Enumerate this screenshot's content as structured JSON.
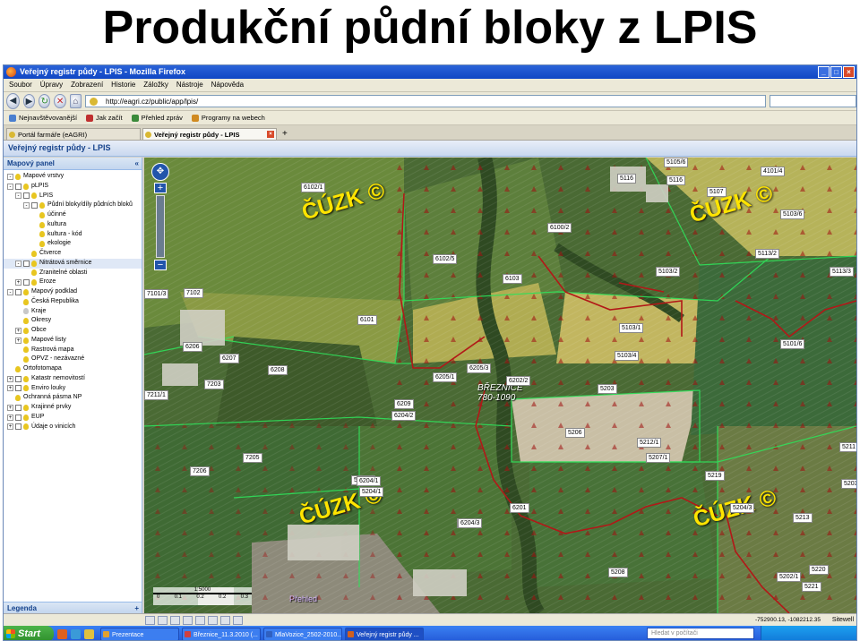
{
  "slide": {
    "title": "Produkční půdní bloky z LPIS"
  },
  "browser": {
    "window_title": "Veřejný registr půdy - LPIS - Mozilla Firefox",
    "menu": [
      "Soubor",
      "Úpravy",
      "Zobrazení",
      "Historie",
      "Záložky",
      "Nástroje",
      "Nápověda"
    ],
    "url": "http://eagri.cz/public/app/lpis/",
    "bookmarks": [
      "Nejnavštěvovanější",
      "Jak začít",
      "Přehled zpráv",
      "Programy na webech"
    ],
    "tabs": [
      {
        "label": "Portál farmáře (eAGRI)",
        "active": false
      },
      {
        "label": "Veřejný registr půdy - LPIS",
        "active": true
      }
    ]
  },
  "app": {
    "header": "Veřejný registr půdy - LPIS",
    "panel_title": "Mapový panel",
    "legend_label": "Legenda"
  },
  "tree": [
    {
      "label": "Mapové vrstvy",
      "level": 0,
      "exp": "-",
      "bulb": "on"
    },
    {
      "label": "pLPIS",
      "level": 0,
      "exp": "-",
      "chk": true,
      "bulb": "on"
    },
    {
      "label": "LPIS",
      "level": 1,
      "exp": "-",
      "chk": true,
      "bulb": "on"
    },
    {
      "label": "Půdní bloky/díly půdních bloků",
      "level": 2,
      "exp": "-",
      "chk": true,
      "bulb": "on"
    },
    {
      "label": "účinné",
      "level": 3,
      "bulb": "on"
    },
    {
      "label": "kultura",
      "level": 3,
      "bulb": "on"
    },
    {
      "label": "kultura - kód",
      "level": 3,
      "bulb": "on"
    },
    {
      "label": "ekologie",
      "level": 3,
      "bulb": "on"
    },
    {
      "label": "Čtverce",
      "level": 2,
      "bulb": "on"
    },
    {
      "label": "Nitrátová směrnice",
      "level": 1,
      "exp": "-",
      "chk": true,
      "bulb": "on",
      "selected": true
    },
    {
      "label": "Zranitelné oblasti",
      "level": 2,
      "bulb": "on"
    },
    {
      "label": "Eroze",
      "level": 1,
      "exp": "+",
      "chk": true,
      "bulb": "on"
    },
    {
      "label": "Mapový podklad",
      "level": 0,
      "exp": "-",
      "chk": true,
      "bulb": "on"
    },
    {
      "label": "Česká Republika",
      "level": 1,
      "bulb": "on"
    },
    {
      "label": "Kraje",
      "level": 1,
      "bulb": "off"
    },
    {
      "label": "Okresy",
      "level": 1,
      "bulb": "on"
    },
    {
      "label": "Obce",
      "level": 1,
      "exp": "+",
      "bulb": "on"
    },
    {
      "label": "Mapové listy",
      "level": 1,
      "exp": "+",
      "bulb": "on"
    },
    {
      "label": "Rastrová mapa",
      "level": 1,
      "bulb": "on"
    },
    {
      "label": "OPVZ - nezávazné",
      "level": 1,
      "bulb": "on"
    },
    {
      "label": "Ortofotomapa",
      "level": 0,
      "bulb": "on"
    },
    {
      "label": "Katastr nemovitostí",
      "level": 0,
      "exp": "+",
      "chk": true,
      "bulb": "on"
    },
    {
      "label": "Enviro louky",
      "level": 0,
      "exp": "+",
      "chk": true,
      "bulb": "on"
    },
    {
      "label": "Ochranná pásma NP",
      "level": 0,
      "bulb": "on"
    },
    {
      "label": "Krajinné prvky",
      "level": 0,
      "exp": "+",
      "chk": true,
      "bulb": "on"
    },
    {
      "label": "EUP",
      "level": 0,
      "exp": "+",
      "chk": true,
      "bulb": "on"
    },
    {
      "label": "Údaje o vinicích",
      "level": 0,
      "exp": "+",
      "chk": true,
      "bulb": "on"
    }
  ],
  "map": {
    "watermark": "ČÚZK ©",
    "village_name": "BŘEZNICE",
    "village_elev": "780-1090",
    "parcels": [
      "6102/1",
      "6102/5",
      "6101",
      "6103",
      "6100/2",
      "5105/6",
      "5116",
      "5116",
      "5107",
      "4101/4",
      "5103/6",
      "5113/2",
      "5113/3",
      "5103/2",
      "5103/1",
      "5101/6",
      "5103/4",
      "5203",
      "5206",
      "5212/1",
      "5207/1",
      "5211",
      "5219",
      "5204/3",
      "5203",
      "5213",
      "5208",
      "5202/1",
      "5220",
      "5221",
      "5204/1",
      "5204/3",
      "5204/1",
      "6201",
      "6205/1",
      "6205/3",
      "6202/2",
      "6206",
      "6207",
      "6208",
      "6209",
      "6204/2",
      "6204/1",
      "6204/3",
      "7102",
      "7203",
      "7211/1",
      "7205",
      "7206",
      "7101/3"
    ],
    "scale_ratio": "1:5000",
    "scale_ticks": [
      "0",
      "0.1",
      "0.2",
      "0.2",
      "0.3"
    ],
    "coords": "-752900.13, -1082212.35",
    "provider": "Sitewell",
    "overview_label": "Přehled"
  },
  "taskbar": {
    "start": "Start",
    "tasks": [
      "Prezentace",
      "Březnice_11.3.2010 (...",
      "MlaVozice_2502-2010...",
      "Veřejný registr půdy ..."
    ],
    "search_placeholder": "Hledat v počítači"
  }
}
